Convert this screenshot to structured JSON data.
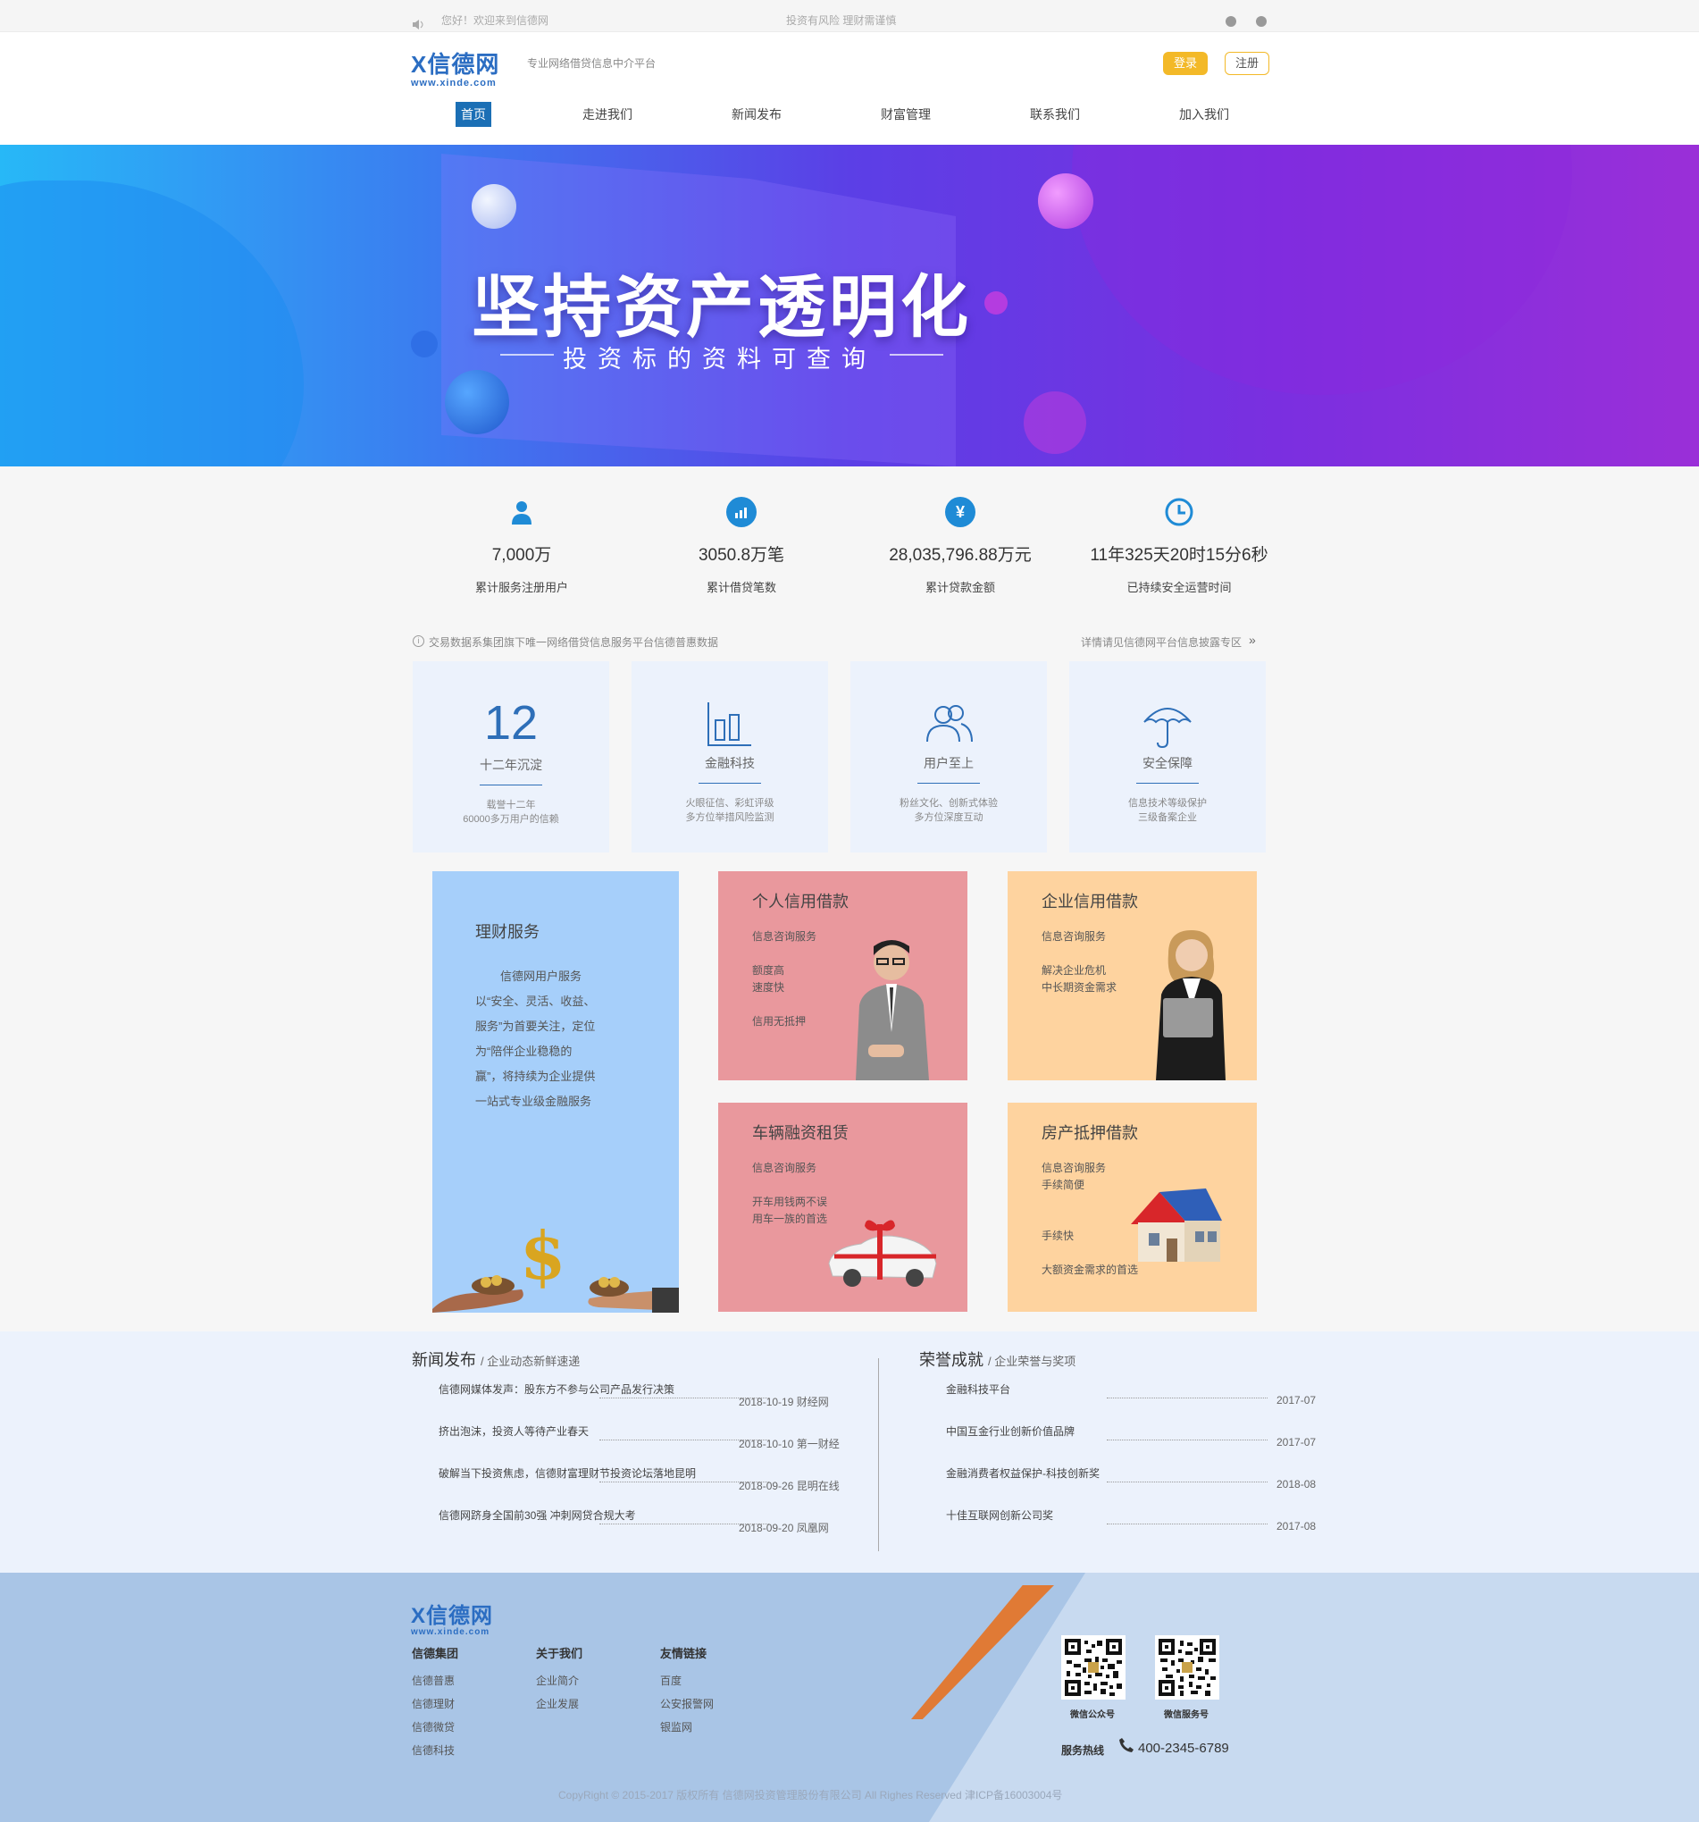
{
  "topbar": {
    "greeting": "您好！欢迎来到信德网",
    "notice": "投资有风险  理财需谨慎"
  },
  "header": {
    "logo_text": "X信德网",
    "logo_sub": "www.xinde.com",
    "slogan": "专业网络借贷信息中介平台",
    "login": "登录",
    "register": "注册"
  },
  "nav": [
    "首页",
    "走进我们",
    "新闻发布",
    "财富管理",
    "联系我们",
    "加入我们"
  ],
  "banner": {
    "title": "坚持资产透明化",
    "subtitle": "投资标的资料可查询"
  },
  "stats": [
    {
      "icon": "user-icon",
      "glyph": "●",
      "value": "7,000万",
      "label": "累计服务注册用户"
    },
    {
      "icon": "chart-icon",
      "glyph": "▮",
      "value": "3050.8万笔",
      "label": "累计借贷笔数"
    },
    {
      "icon": "yuan-icon",
      "glyph": "¥",
      "value": "28,035,796.88万元",
      "label": "累计贷款金额"
    },
    {
      "icon": "clock-icon",
      "glyph": "◷",
      "value": "11年325天20时15分6秒",
      "label": "已持续安全运营时间"
    }
  ],
  "info": {
    "left": "交易数据系集团旗下唯一网络借贷信息服务平台信德普惠数据",
    "right": "详情请见信德网平台信息披露专区"
  },
  "features": [
    {
      "big": "12",
      "title": "十二年沉淀",
      "desc1": "载誉十二年",
      "desc2": "60000多万用户的信赖"
    },
    {
      "icon": "bar-chart-icon",
      "title": "金融科技",
      "desc1": "火眼征信、彩虹评级",
      "desc2": "多方位举措风险监测"
    },
    {
      "icon": "users-icon",
      "title": "用户至上",
      "desc1": "粉丝文化、创新式体验",
      "desc2": "多方位深度互动"
    },
    {
      "icon": "umbrella-icon",
      "title": "安全保障",
      "desc1": "信息技术等级保护",
      "desc2": "三级备案企业"
    }
  ],
  "services": {
    "wealth": {
      "title": "理财服务",
      "lines": [
        "信德网用户服务",
        "以“安全、灵活、收益、",
        "服务”为首要关注，定位",
        "为“陪伴企业稳稳的",
        "赢”，将持续为企业提供",
        "一站式专业级金融服务"
      ]
    },
    "personal": {
      "title": "个人信用借款",
      "l1": "信息咨询服务",
      "l2": "额度高",
      "l3": "速度快",
      "l4": "信用无抵押"
    },
    "enterprise": {
      "title": "企业信用借款",
      "l1": "信息咨询服务",
      "l2": "解决企业危机",
      "l3": "中长期资金需求"
    },
    "vehicle": {
      "title": "车辆融资租赁",
      "l1": "信息咨询服务",
      "l2": "开车用钱两不误",
      "l3": "用车一族的首选"
    },
    "house": {
      "title": "房产抵押借款",
      "l1": "信息咨询服务",
      "l2": "手续简便",
      "l3": "手续快",
      "l4": "大额资金需求的首选"
    }
  },
  "news": {
    "title": "新闻发布",
    "subtitle": "/ 企业动态新鲜速递",
    "items": [
      {
        "title": "信德网媒体发声：股东方不参与公司产品发行决策",
        "meta": "2018-10-19 财经网"
      },
      {
        "title": "挤出泡沫，投资人等待产业春天",
        "meta": "2018-10-10 第一财经"
      },
      {
        "title": "破解当下投资焦虑，信德财富理财节投资论坛落地昆明",
        "meta": "2018-09-26 昆明在线"
      },
      {
        "title": "信德网跻身全国前30强 冲刺网贷合规大考",
        "meta": "2018-09-20 凤凰网"
      }
    ]
  },
  "honors": {
    "title": "荣誉成就",
    "subtitle": "/ 企业荣誉与奖项",
    "items": [
      {
        "title": "金融科技平台",
        "meta": "2017-07"
      },
      {
        "title": "中国互金行业创新价值品牌",
        "meta": "2017-07"
      },
      {
        "title": "金融消费者权益保护-科技创新奖",
        "meta": "2018-08"
      },
      {
        "title": "十佳互联网创新公司奖",
        "meta": "2017-08"
      }
    ]
  },
  "footer": {
    "logo_text": "X信德网",
    "logo_sub": "www.xinde.com",
    "cols": [
      {
        "title": "信德集团",
        "items": [
          "信德普惠",
          "信德理财",
          "信德微贷",
          "信德科技"
        ]
      },
      {
        "title": "关于我们",
        "items": [
          "企业简介",
          "企业发展"
        ]
      },
      {
        "title": "友情链接",
        "items": [
          "百度",
          "公安报警网",
          "银监网"
        ]
      }
    ],
    "qr1": "微信公众号",
    "qr2": "微信服务号",
    "hotline_label": "服务热线",
    "hotline": "400-2345-6789",
    "copyright": "CopyRight © 2015-2017 版权所有 信德网投资管理股份有限公司 All Righes Reserved 津ICP备16003004号"
  },
  "colors": {
    "brand": "#1b6fb5",
    "login": "#f3b928",
    "card_blue": "#a6cffa",
    "card_pink": "#e9989d",
    "card_orange": "#fed39f",
    "footer": "#a9c5e6"
  }
}
